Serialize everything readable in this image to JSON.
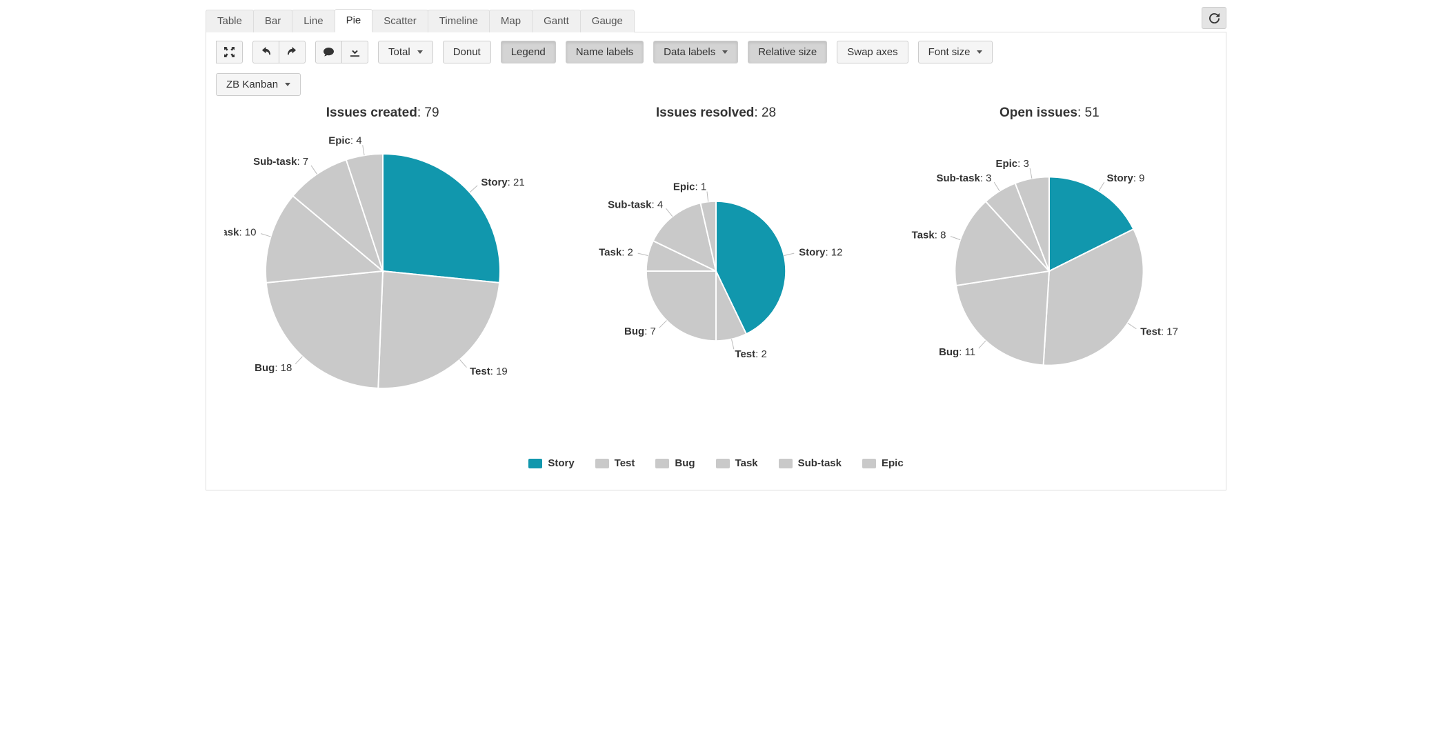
{
  "tabs": [
    {
      "id": "table",
      "label": "Table",
      "active": false
    },
    {
      "id": "bar",
      "label": "Bar",
      "active": false
    },
    {
      "id": "line",
      "label": "Line",
      "active": false
    },
    {
      "id": "pie",
      "label": "Pie",
      "active": true
    },
    {
      "id": "scatter",
      "label": "Scatter",
      "active": false
    },
    {
      "id": "timeline",
      "label": "Timeline",
      "active": false
    },
    {
      "id": "map",
      "label": "Map",
      "active": false
    },
    {
      "id": "gantt",
      "label": "Gantt",
      "active": false
    },
    {
      "id": "gauge",
      "label": "Gauge",
      "active": false
    }
  ],
  "reload_icon": "reload",
  "toolbar": {
    "icon_buttons_1": [
      {
        "id": "expand",
        "icon": "expand"
      }
    ],
    "icon_buttons_2": [
      {
        "id": "undo",
        "icon": "undo"
      },
      {
        "id": "redo",
        "icon": "redo"
      }
    ],
    "icon_buttons_3": [
      {
        "id": "annotate",
        "icon": "comment"
      },
      {
        "id": "download",
        "icon": "download"
      }
    ],
    "controls": [
      {
        "id": "total",
        "label": "Total",
        "dropdown": true,
        "active": false
      },
      {
        "id": "donut",
        "label": "Donut",
        "dropdown": false,
        "active": false
      },
      {
        "id": "legend",
        "label": "Legend",
        "dropdown": false,
        "active": true
      },
      {
        "id": "name-labels",
        "label": "Name labels",
        "dropdown": false,
        "active": true
      },
      {
        "id": "data-labels",
        "label": "Data labels",
        "dropdown": true,
        "active": true
      },
      {
        "id": "relative-size",
        "label": "Relative size",
        "dropdown": false,
        "active": true
      },
      {
        "id": "swap-axes",
        "label": "Swap axes",
        "dropdown": false,
        "active": false
      },
      {
        "id": "font-size",
        "label": "Font size",
        "dropdown": true,
        "active": false
      }
    ],
    "project_selector": {
      "label": "ZB Kanban",
      "dropdown": true
    }
  },
  "legend_items": [
    {
      "name": "Story",
      "color": "#1197ad"
    },
    {
      "name": "Test",
      "color": "#c9c9c9"
    },
    {
      "name": "Bug",
      "color": "#c9c9c9"
    },
    {
      "name": "Task",
      "color": "#c9c9c9"
    },
    {
      "name": "Sub-task",
      "color": "#c9c9c9"
    },
    {
      "name": "Epic",
      "color": "#c9c9c9"
    }
  ],
  "colors": {
    "Story": "#1197ad",
    "default": "#c9c9c9"
  },
  "chart_data": {
    "type": "pie",
    "relative_size": true,
    "legend": [
      "Story",
      "Test",
      "Bug",
      "Task",
      "Sub-task",
      "Epic"
    ],
    "pies": [
      {
        "title": "Issues created",
        "total": 79,
        "slices": [
          {
            "name": "Story",
            "value": 21
          },
          {
            "name": "Test",
            "value": 19
          },
          {
            "name": "Bug",
            "value": 18
          },
          {
            "name": "Task",
            "value": 10
          },
          {
            "name": "Sub-task",
            "value": 7
          },
          {
            "name": "Epic",
            "value": 4
          }
        ]
      },
      {
        "title": "Issues resolved",
        "total": 28,
        "slices": [
          {
            "name": "Story",
            "value": 12
          },
          {
            "name": "Test",
            "value": 2
          },
          {
            "name": "Bug",
            "value": 7
          },
          {
            "name": "Task",
            "value": 2
          },
          {
            "name": "Sub-task",
            "value": 4
          },
          {
            "name": "Epic",
            "value": 1
          }
        ]
      },
      {
        "title": "Open issues",
        "total": 51,
        "slices": [
          {
            "name": "Story",
            "value": 9
          },
          {
            "name": "Test",
            "value": 17
          },
          {
            "name": "Bug",
            "value": 11
          },
          {
            "name": "Task",
            "value": 8
          },
          {
            "name": "Sub-task",
            "value": 3
          },
          {
            "name": "Epic",
            "value": 3
          }
        ]
      }
    ]
  }
}
